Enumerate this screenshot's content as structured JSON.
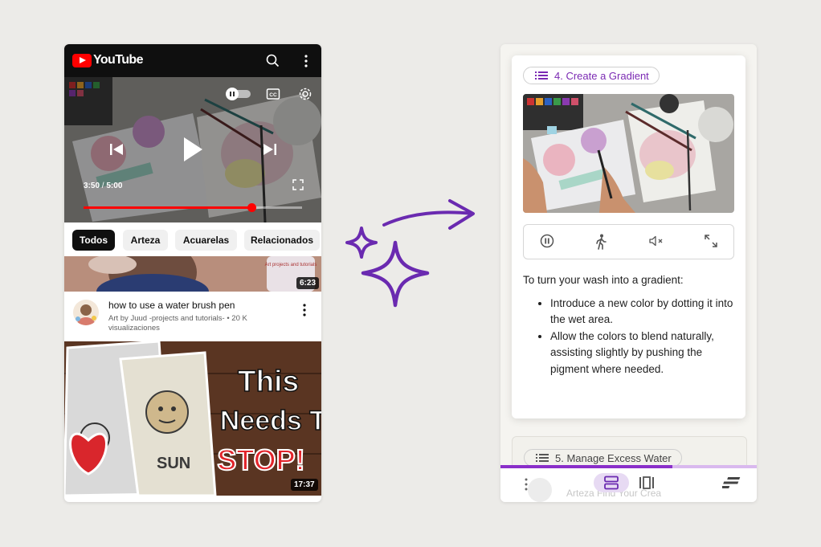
{
  "youtube": {
    "logo_text": "YouTube",
    "icons": [
      "search-icon",
      "more-vert-icon",
      "autoplay-toggle-icon",
      "cc-icon",
      "settings-icon",
      "previous-icon",
      "play-icon",
      "next-icon",
      "fullscreen-icon"
    ],
    "player": {
      "time_current": "3:50",
      "time_separator": " / ",
      "time_total": "5:00",
      "progress_fraction": 0.767
    },
    "chips": [
      "Todos",
      "Arteza",
      "Acuarelas",
      "Relacionados"
    ],
    "videos": [
      {
        "duration": "6:23",
        "thumb_text": "Art projects and tutorials",
        "title": "how to use a water brush pen",
        "channel": "Art by Juud -projects and tutorials-",
        "views": "• 20 K visualizaciones"
      },
      {
        "duration": "17:37",
        "thumb_line1": "This",
        "thumb_line2": "Needs To",
        "thumb_line3": "STOP!",
        "thumb_sun": "SUN"
      }
    ]
  },
  "lesson": {
    "step_current": "4. Create a Gradient",
    "intro": "To turn your wash into a gradient:",
    "bullets": [
      "Introduce a new color by dotting it into the wet area.",
      "Allow the colors to blend naturally, assisting slightly by pushing the pigment where needed."
    ],
    "step_next": "5. Manage Excess Water",
    "controls": [
      "pause-icon",
      "walk-icon",
      "mute-icon",
      "expand-icon"
    ],
    "bottom_bar": {
      "behind_text": "Arteza Find Your Crea",
      "progress_fraction": 0.67,
      "buttons": [
        "more-icon",
        "stacked-view-icon",
        "carousel-view-icon",
        "list-align-icon"
      ]
    }
  },
  "colors": {
    "youtube_red": "#ff0000",
    "accent_purple": "#7b2ab3",
    "arrow_purple": "#6a2ab0"
  }
}
